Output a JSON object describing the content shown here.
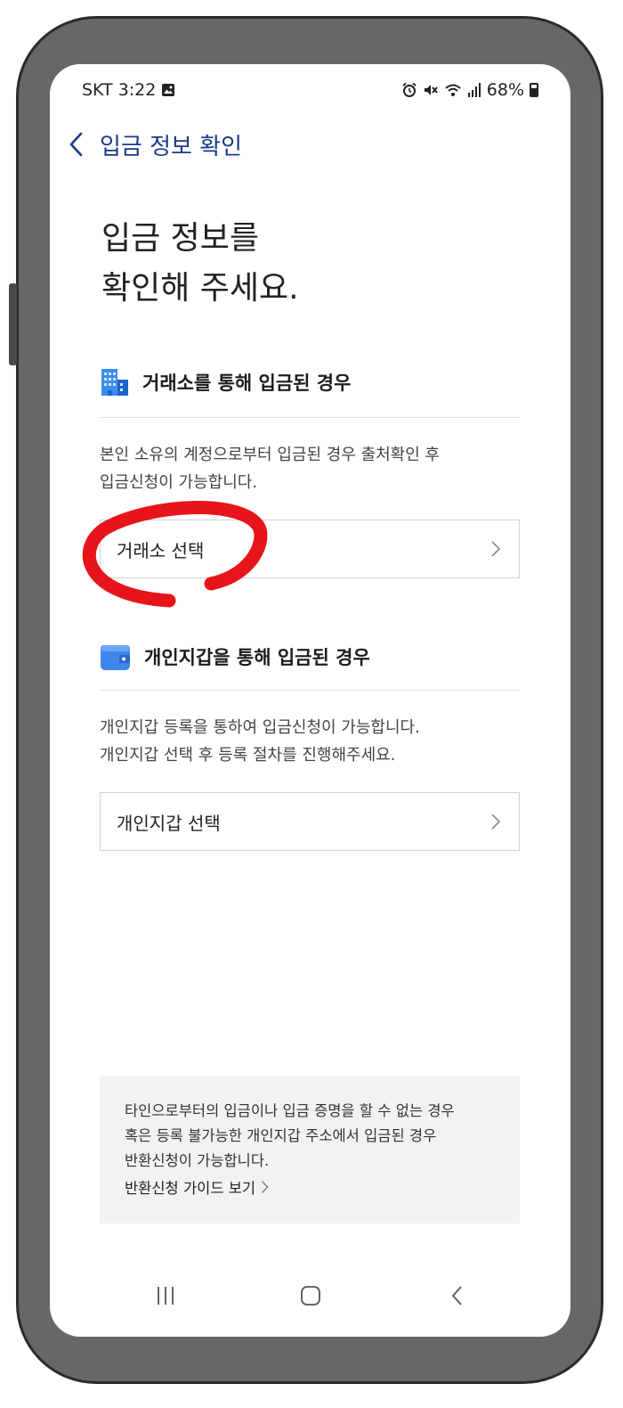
{
  "status_bar": {
    "carrier_time": "SKT 3:22",
    "battery": "68%",
    "icons": [
      "gallery-icon",
      "alarm-icon",
      "mute-icon",
      "wifi-icon",
      "signal-icon",
      "battery-icon"
    ]
  },
  "header": {
    "title": "입금 정보 확인"
  },
  "page": {
    "title_line1": "입금 정보를",
    "title_line2": "확인해 주세요."
  },
  "exchange": {
    "heading": "거래소를 통해 입금된 경우",
    "desc_line1": "본인 소유의 계정으로부터 입금된 경우 출처확인 후",
    "desc_line2": "입금신청이 가능합니다.",
    "select_label": "거래소 선택"
  },
  "wallet": {
    "heading": "개인지갑을 통해 입금된 경우",
    "desc_line1": "개인지갑 등록을 통하여 입금신청이 가능합니다.",
    "desc_line2": "개인지갑 선택 후 등록 절차를 진행해주세요.",
    "select_label": "개인지갑 선택"
  },
  "notice": {
    "line1": "타인으로부터의 입금이나 입금 증명을 할 수 없는 경우",
    "line2": "혹은 등록 불가능한 개인지갑 주소에서 입금된 경우",
    "line3": "반환신청이 가능합니다.",
    "link": "반환신청 가이드 보기"
  },
  "colors": {
    "accent": "#1a3a86",
    "annotation": "#e8141b",
    "frame": "#676767"
  }
}
